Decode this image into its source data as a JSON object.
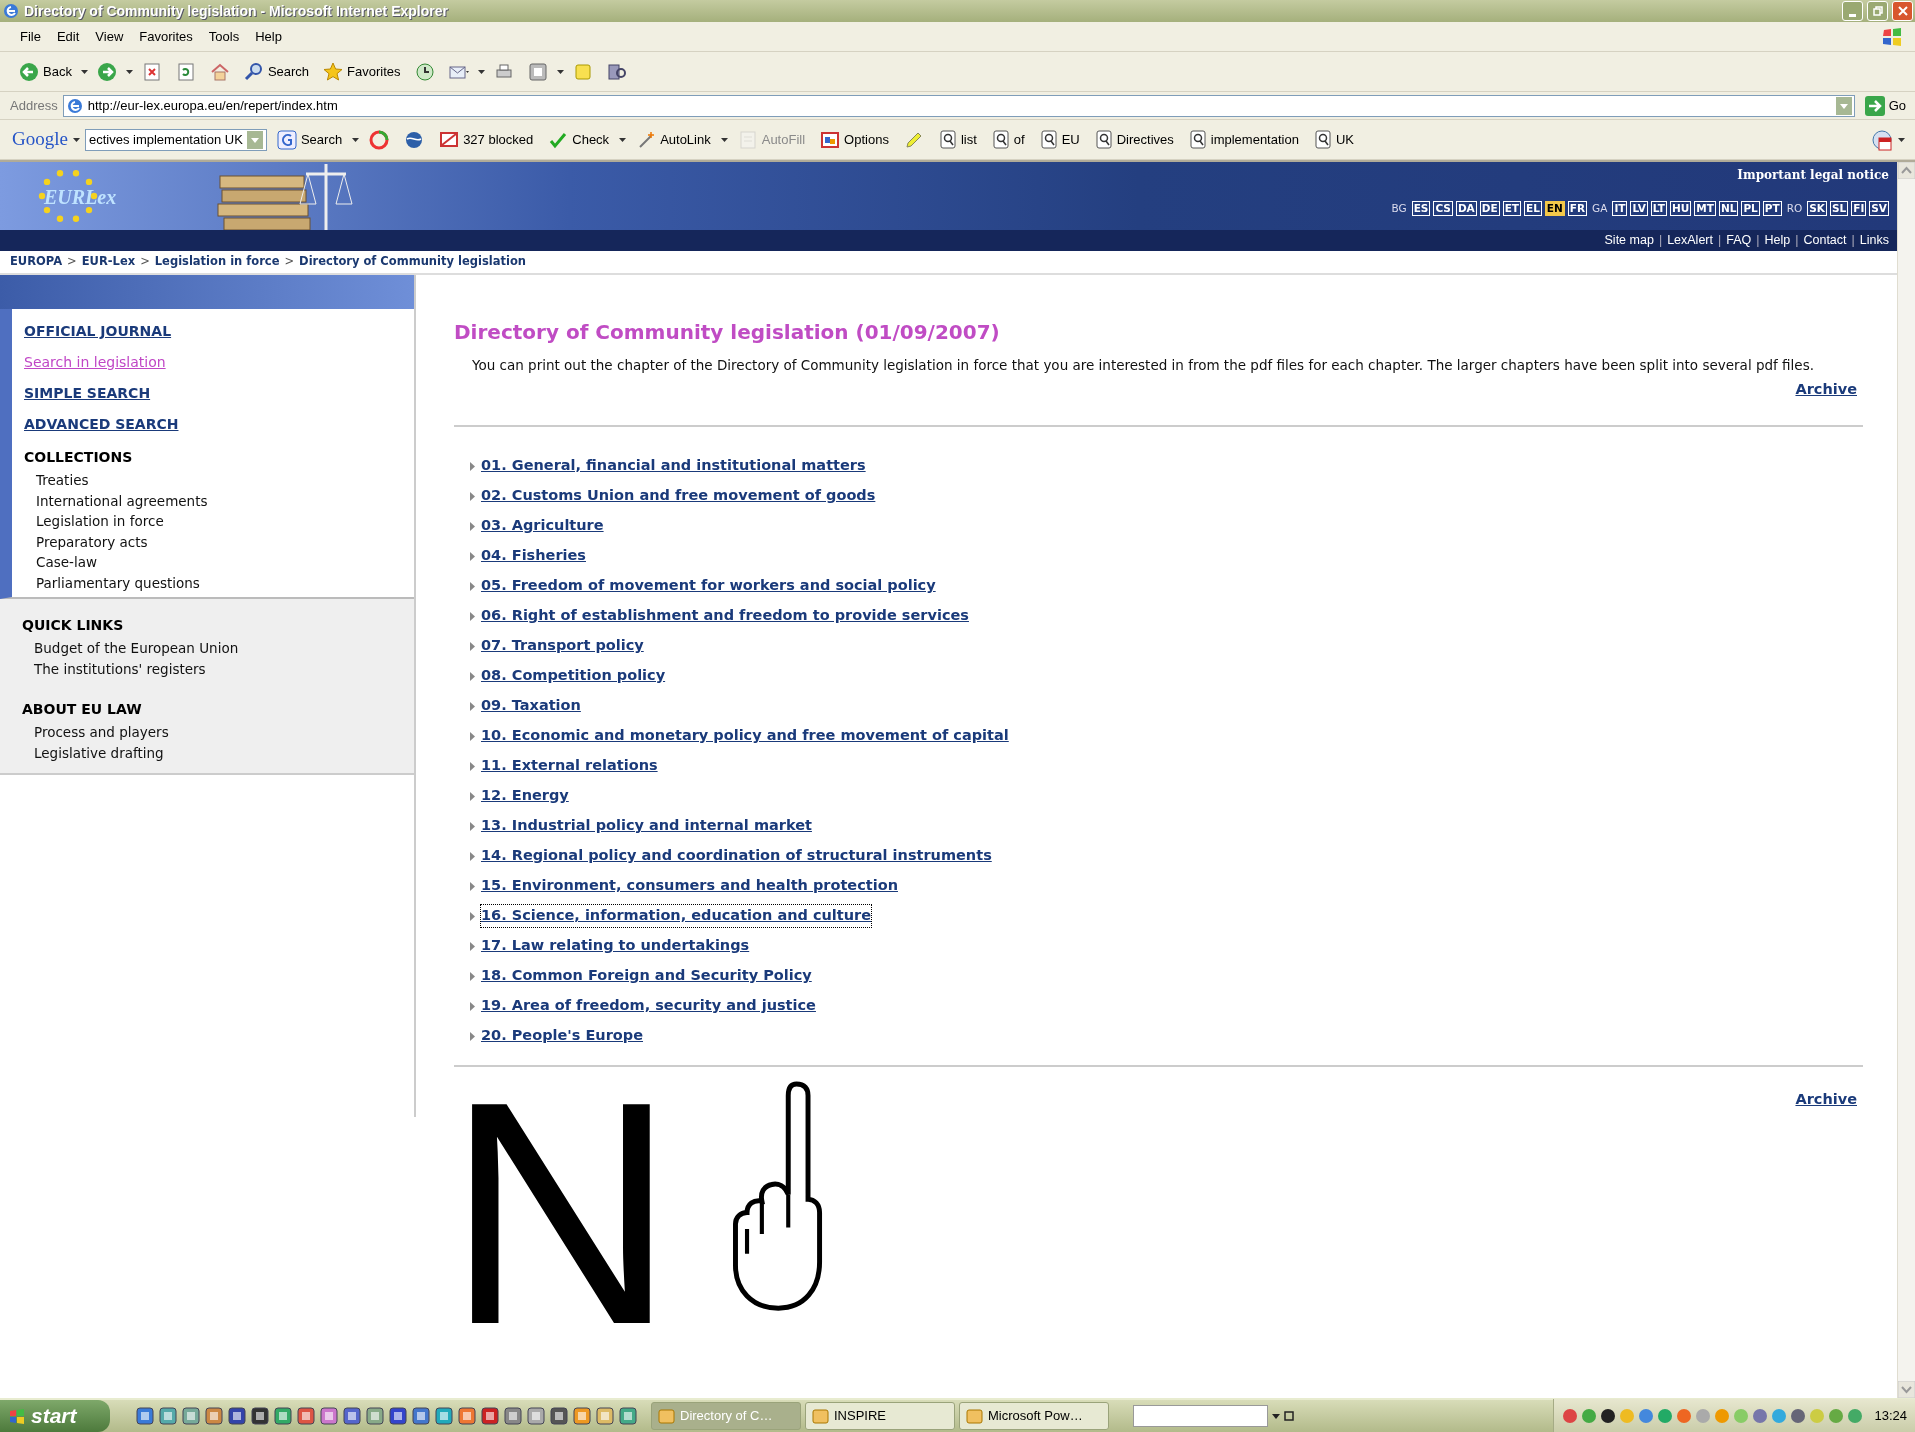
{
  "window": {
    "title": "Directory of Community legislation - Microsoft Internet Explorer"
  },
  "menu": [
    "File",
    "Edit",
    "View",
    "Favorites",
    "Tools",
    "Help"
  ],
  "toolbar": [
    {
      "kind": "back",
      "label": "Back"
    },
    {
      "kind": "forward"
    },
    {
      "kind": "stop"
    },
    {
      "kind": "refresh"
    },
    {
      "kind": "home"
    },
    {
      "kind": "search",
      "label": "Search"
    },
    {
      "kind": "favorites",
      "label": "Favorites"
    },
    {
      "kind": "history"
    },
    {
      "kind": "mail"
    },
    {
      "kind": "print"
    },
    {
      "kind": "edit"
    },
    {
      "kind": "note"
    },
    {
      "kind": "research"
    }
  ],
  "address": {
    "label": "Address",
    "value": "http://eur-lex.europa.eu/en/repert/index.htm",
    "go": "Go"
  },
  "google_bar": {
    "logo": "Google",
    "query": "ectives implementation UK",
    "items": [
      {
        "kind": "search",
        "label": "Search",
        "disabled": false
      },
      {
        "kind": "pagerank",
        "disabled": false
      },
      {
        "kind": "globe",
        "disabled": false
      },
      {
        "kind": "blocker",
        "label": "327 blocked",
        "disabled": false
      },
      {
        "kind": "check",
        "label": "Check",
        "disabled": false
      },
      {
        "kind": "autolink",
        "label": "AutoLink",
        "disabled": false
      },
      {
        "kind": "autofill",
        "label": "AutoFill",
        "disabled": true
      },
      {
        "kind": "options",
        "label": "Options",
        "disabled": false
      },
      {
        "kind": "highlight",
        "disabled": false
      }
    ],
    "terms": [
      "list",
      "of",
      "EU",
      "Directives",
      "implementation",
      "UK"
    ]
  },
  "header": {
    "logo": "EURLex",
    "legal_notice": "Important legal notice",
    "languages": [
      {
        "code": "BG",
        "available": false,
        "selected": false
      },
      {
        "code": "ES",
        "available": true,
        "selected": false
      },
      {
        "code": "CS",
        "available": true,
        "selected": false
      },
      {
        "code": "DA",
        "available": true,
        "selected": false
      },
      {
        "code": "DE",
        "available": true,
        "selected": false
      },
      {
        "code": "ET",
        "available": true,
        "selected": false
      },
      {
        "code": "EL",
        "available": true,
        "selected": false
      },
      {
        "code": "EN",
        "available": true,
        "selected": true
      },
      {
        "code": "FR",
        "available": true,
        "selected": false
      },
      {
        "code": "GA",
        "available": false,
        "selected": false
      },
      {
        "code": "IT",
        "available": true,
        "selected": false
      },
      {
        "code": "LV",
        "available": true,
        "selected": false
      },
      {
        "code": "LT",
        "available": true,
        "selected": false
      },
      {
        "code": "HU",
        "available": true,
        "selected": false
      },
      {
        "code": "MT",
        "available": true,
        "selected": false
      },
      {
        "code": "NL",
        "available": true,
        "selected": false
      },
      {
        "code": "PL",
        "available": true,
        "selected": false
      },
      {
        "code": "PT",
        "available": true,
        "selected": false
      },
      {
        "code": "RO",
        "available": false,
        "selected": false
      },
      {
        "code": "SK",
        "available": true,
        "selected": false
      },
      {
        "code": "SL",
        "available": true,
        "selected": false
      },
      {
        "code": "FI",
        "available": true,
        "selected": false
      },
      {
        "code": "SV",
        "available": true,
        "selected": false
      }
    ],
    "links": [
      {
        "kind": "link",
        "text": "Site map"
      },
      {
        "kind": "separator",
        "text": "|"
      },
      {
        "kind": "link",
        "text": "LexAlert"
      },
      {
        "kind": "separator",
        "text": "|"
      },
      {
        "kind": "link",
        "text": "FAQ"
      },
      {
        "kind": "separator",
        "text": "|"
      },
      {
        "kind": "link",
        "text": "Help"
      },
      {
        "kind": "separator",
        "text": "|"
      },
      {
        "kind": "link",
        "text": "Contact"
      },
      {
        "kind": "separator",
        "text": "|"
      },
      {
        "kind": "link",
        "text": "Links"
      }
    ]
  },
  "breadcrumb": [
    {
      "kind": "link",
      "text": "EUROPA"
    },
    {
      "kind": "separator",
      "text": ">"
    },
    {
      "kind": "link",
      "text": "EUR-Lex"
    },
    {
      "kind": "separator",
      "text": ">"
    },
    {
      "kind": "link",
      "text": "Legislation in force"
    },
    {
      "kind": "separator",
      "text": ">"
    },
    {
      "kind": "link",
      "text": "Directory of Community legislation"
    }
  ],
  "sidebar": {
    "main_links": [
      {
        "text": "OFFICIAL JOURNAL",
        "visited": false
      },
      {
        "text": "Search in legislation",
        "visited": true
      },
      {
        "text": "SIMPLE SEARCH",
        "visited": false
      },
      {
        "text": "ADVANCED SEARCH",
        "visited": false
      }
    ],
    "collections": {
      "heading": "COLLECTIONS",
      "items": [
        "Treaties",
        "International agreements",
        "Legislation in force",
        "Preparatory acts",
        "Case-law",
        "Parliamentary questions"
      ]
    },
    "quick_links": {
      "heading": "QUICK LINKS",
      "items": [
        "Budget of the European Union",
        "The institutions' registers"
      ]
    },
    "about": {
      "heading": "ABOUT EU LAW",
      "items": [
        "Process and players",
        "Legislative drafting"
      ]
    }
  },
  "content": {
    "title": "Directory of Community legislation (01/09/2007)",
    "intro": "You can print out the chapter of the Directory of Community legislation in force that you are interested in from the pdf files for each chapter. The larger chapters have been split into several pdf files.",
    "archive_top": "Archive",
    "chapters": [
      {
        "text": "01. General, financial and institutional matters",
        "focused": false
      },
      {
        "text": "02. Customs Union and free movement of goods",
        "focused": false
      },
      {
        "text": "03. Agriculture",
        "focused": false
      },
      {
        "text": "04. Fisheries",
        "focused": false
      },
      {
        "text": "05. Freedom of movement for workers and social policy",
        "focused": false
      },
      {
        "text": "06. Right of establishment and freedom to provide services",
        "focused": false
      },
      {
        "text": "07. Transport policy",
        "focused": false
      },
      {
        "text": "08. Competition policy",
        "focused": false
      },
      {
        "text": "09. Taxation",
        "focused": false
      },
      {
        "text": "10. Economic and monetary policy and free movement of capital",
        "focused": false
      },
      {
        "text": "11. External relations",
        "focused": false
      },
      {
        "text": "12. Energy",
        "focused": false
      },
      {
        "text": "13. Industrial policy and internal market",
        "focused": false
      },
      {
        "text": "14. Regional policy and coordination of structural instruments",
        "focused": false
      },
      {
        "text": "15. Environment, consumers and health protection",
        "focused": false
      },
      {
        "text": "16. Science, information, education and culture",
        "focused": true
      },
      {
        "text": "17. Law relating to undertakings",
        "focused": false
      },
      {
        "text": "18. Common Foreign and Security Policy",
        "focused": false
      },
      {
        "text": "19. Area of freedom, security and justice",
        "focused": false
      },
      {
        "text": "20. People's Europe",
        "focused": false
      }
    ],
    "archive_bottom": "Archive"
  },
  "overlay": {
    "letter": "N"
  },
  "taskbar": {
    "start": "start",
    "tasks": [
      {
        "label": "Directory of C…",
        "selected": true
      },
      {
        "label": "INSPIRE",
        "selected": false
      },
      {
        "label": "Microsoft Pow…",
        "selected": false
      }
    ],
    "clock": "13:24"
  }
}
